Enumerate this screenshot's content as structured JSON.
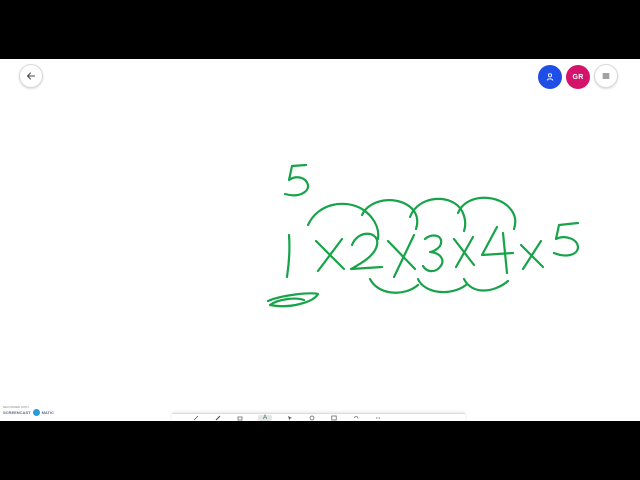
{
  "topbar": {
    "back_icon": "arrow-left-icon",
    "user_icon": "person-icon",
    "user_color": "#1e4ee6",
    "initials": "GR",
    "initials_color": "#d4146a",
    "menu_icon": "hamburger-menu-icon"
  },
  "board": {
    "background": "#ffffff",
    "ink_color": "#17a34a",
    "handwriting": {
      "top_number": "5",
      "expression": "1 X 2 X 3 X 4 X 5"
    }
  },
  "watermark": {
    "line1": "RECORDED WITH",
    "brand": "SCREENCAST",
    "brand_suffix": "MATIC"
  },
  "toolbar": {
    "tools": [
      "pen-tool",
      "highlighter-tool",
      "eraser-tool",
      "text-tool",
      "select-tool",
      "shape-tool",
      "image-tool",
      "undo-tool",
      "more-tool"
    ],
    "active_tool_label": "A"
  }
}
